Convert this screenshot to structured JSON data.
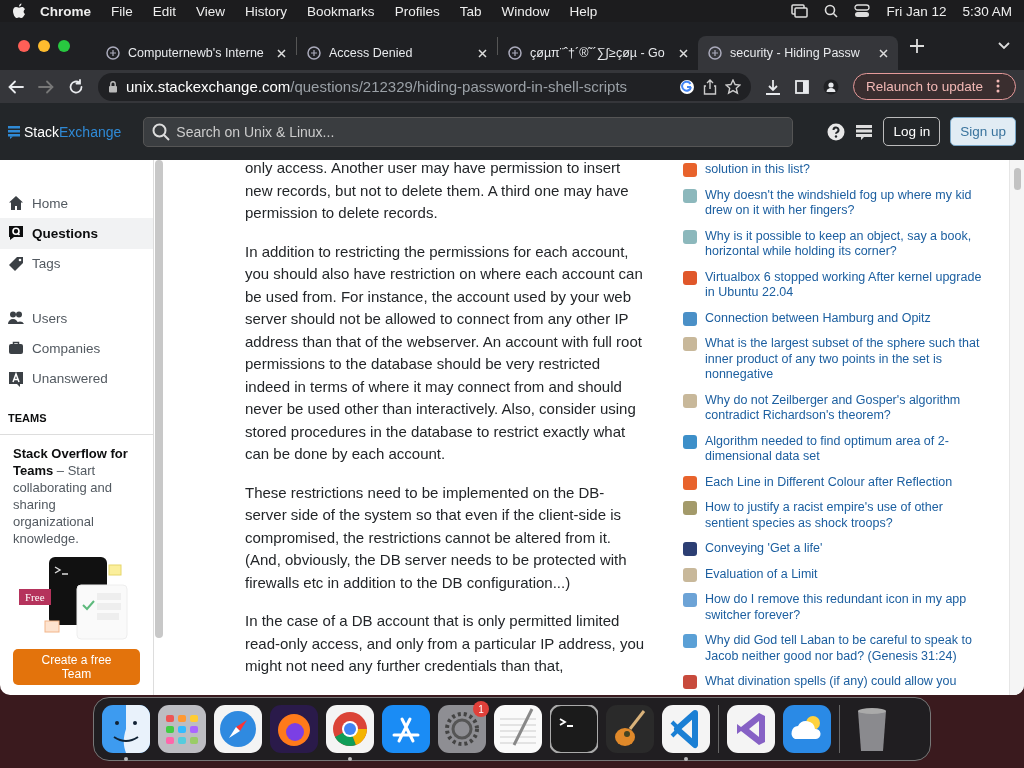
{
  "menu_bar": {
    "app": "Chrome",
    "items": [
      "File",
      "Edit",
      "View",
      "History",
      "Bookmarks",
      "Profiles",
      "Tab",
      "Window",
      "Help"
    ],
    "date": "Fri Jan 12",
    "time": "5:30 AM"
  },
  "tabs": [
    {
      "title": "Computernewb's Interne",
      "selected": false
    },
    {
      "title": "Access Denied",
      "selected": false
    },
    {
      "title": "çøµπ¨ˆ†´®˜´∑∫≥çøµ - Go",
      "selected": false
    },
    {
      "title": "security - Hiding Passw",
      "selected": true
    }
  ],
  "address_bar": {
    "host": "unix.stackexchange.com",
    "path": "/questions/212329/hiding-password-in-shell-scripts",
    "relaunch": "Relaunch to update"
  },
  "site_header": {
    "logo_first": "Stack",
    "logo_second": "Exchange",
    "search_placeholder": "Search on Unix & Linux...",
    "login": "Log in",
    "signup": "Sign up"
  },
  "sidebar": {
    "nav_groups": [
      {
        "items": [
          {
            "label": "Home",
            "selected": false
          },
          {
            "label": "Questions",
            "selected": true
          },
          {
            "label": "Tags",
            "selected": false
          }
        ]
      },
      {
        "items": [
          {
            "label": "Users",
            "selected": false
          },
          {
            "label": "Companies",
            "selected": false
          },
          {
            "label": "Unanswered",
            "selected": false
          }
        ]
      }
    ],
    "teams_heading": "TEAMS",
    "teams_text": "**Stack Overflow for Teams** – Start collaborating and sharing organizational knowledge.",
    "badge": "Free",
    "button": "Create a free Team"
  },
  "answer_paragraphs": [
    "only access. Another user may have permission to insert new records, but not to delete them. A third one may have permission to delete records.",
    "In addition to restricting the permissions for each account, you should also have restriction on where each account can be used from. For instance, the account used by your web server should not be allowed to connect from any other IP address than that of the webserver. An account with full root permissions to the database should be very restricted indeed in terms of where it may connect from and should never be used other than interactively. Also, consider using stored procedures in the database to restrict exactly what can be done by each account.",
    "These restrictions need to be implemented on the DB-server side of the system so that even if the client-side is compromised, the restrictions cannot be altered from it. (And, obviously, the DB server needs to be protected with firewalls etc in addition to the DB configuration...)",
    "In the case of a DB account that is only permitted limited read-only access, and only from a particular IP address, you might not need any further credentials than that,"
  ],
  "hot_questions": [
    {
      "title": "solution in this list?",
      "color": "#e8632c"
    },
    {
      "title": "Why doesn't the windshield fog up where my kid drew on it with her fingers?",
      "color": "#8cb8bc"
    },
    {
      "title": "Why is it possible to keep an object, say a book, horizontal while holding its corner?",
      "color": "#8cb8bc"
    },
    {
      "title": "Virtualbox 6 stopped working After kernel upgrade in Ubuntu 22.04",
      "color": "#e0572a"
    },
    {
      "title": "Connection between Hamburg and Opitz",
      "color": "#4a90c7"
    },
    {
      "title": "What is the largest subset of the sphere such that inner product of any two points in the set is nonnegative",
      "color": "#c8b89a"
    },
    {
      "title": "Why do not Zeilberger and Gosper's algorithm contradict Richardson's theorem?",
      "color": "#c8b89a"
    },
    {
      "title": "Algorithm needed to find optimum area of 2-dimensional data set",
      "color": "#3d8fc9"
    },
    {
      "title": "Each Line in Different Colour after Reflection",
      "color": "#e8632c"
    },
    {
      "title": "How to justify a racist empire's use of other sentient species as shock troops?",
      "color": "#a39a6a"
    },
    {
      "title": "Conveying 'Get a life'",
      "color": "#2c3e73"
    },
    {
      "title": "Evaluation of a Limit",
      "color": "#c8b89a"
    },
    {
      "title": "How do I remove this redundant icon in my app switcher forever?",
      "color": "#6ca3d6"
    },
    {
      "title": "Why did God tell Laban to be careful to speak to Jacob neither good nor bad? (Genesis 31:24)",
      "color": "#5aa0d6"
    },
    {
      "title": "What divination spells (if any) could allow you",
      "color": "#c84a3c"
    }
  ],
  "dock": [
    {
      "kind": "finder",
      "running": true
    },
    {
      "kind": "launchpad",
      "running": false
    },
    {
      "kind": "compass",
      "running": false
    },
    {
      "kind": "fox",
      "running": false
    },
    {
      "kind": "chrome",
      "running": true
    },
    {
      "kind": "appstore",
      "running": false
    },
    {
      "kind": "settings",
      "running": false,
      "badge": "1"
    },
    {
      "kind": "notes",
      "running": false
    },
    {
      "kind": "terminal",
      "running": false
    },
    {
      "kind": "guitar",
      "running": false
    },
    {
      "kind": "vscode",
      "running": true
    },
    {
      "kind": "separator"
    },
    {
      "kind": "vs",
      "running": false
    },
    {
      "kind": "weather",
      "running": false
    },
    {
      "kind": "separator"
    },
    {
      "kind": "trash",
      "running": false
    }
  ]
}
